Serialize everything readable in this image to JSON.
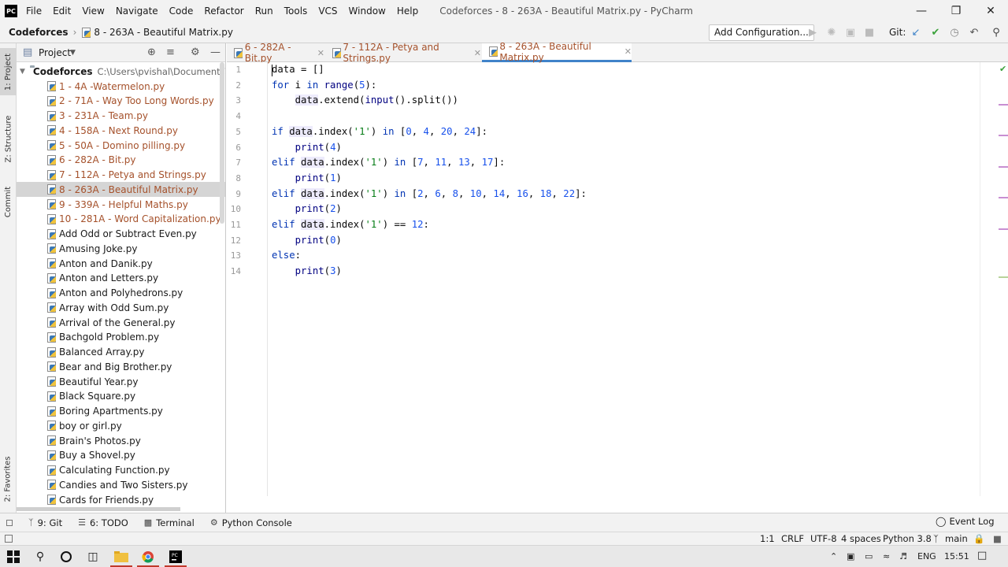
{
  "app": {
    "logo": "PC",
    "window_title": "Codeforces - 8 - 263A - Beautiful Matrix.py - PyCharm",
    "menu": [
      "File",
      "Edit",
      "View",
      "Navigate",
      "Code",
      "Refactor",
      "Run",
      "Tools",
      "VCS",
      "Window",
      "Help"
    ]
  },
  "navbar": {
    "project": "Codeforces",
    "file": "8 - 263A - Beautiful Matrix.py",
    "add_configuration": "Add Configuration...",
    "git_label": "Git:"
  },
  "left_strip": {
    "project_tab": "1: Project",
    "structure_tab": "Z: Structure",
    "commit_tab": "Commit",
    "favorites_tab": "2: Favorites"
  },
  "project_panel": {
    "title": "Project",
    "root_name": "Codeforces",
    "root_path": "C:\\Users\\pvishal\\Documents\\Cod",
    "files": [
      {
        "name": "1 - 4A -Watermelon.py",
        "modified": true,
        "selected": false
      },
      {
        "name": "2 - 71A - Way Too Long Words.py",
        "modified": true,
        "selected": false
      },
      {
        "name": "3 - 231A - Team.py",
        "modified": true,
        "selected": false
      },
      {
        "name": "4 - 158A - Next Round.py",
        "modified": true,
        "selected": false
      },
      {
        "name": "5 - 50A - Domino pilling.py",
        "modified": true,
        "selected": false
      },
      {
        "name": "6 - 282A - Bit.py",
        "modified": true,
        "selected": false
      },
      {
        "name": "7 - 112A - Petya and Strings.py",
        "modified": true,
        "selected": false
      },
      {
        "name": "8 - 263A - Beautiful Matrix.py",
        "modified": true,
        "selected": true
      },
      {
        "name": "9 - 339A - Helpful Maths.py",
        "modified": true,
        "selected": false
      },
      {
        "name": "10 - 281A - Word Capitalization.py",
        "modified": true,
        "selected": false
      },
      {
        "name": "Add Odd or Subtract Even.py",
        "modified": false,
        "selected": false
      },
      {
        "name": "Amusing Joke.py",
        "modified": false,
        "selected": false
      },
      {
        "name": "Anton and Danik.py",
        "modified": false,
        "selected": false
      },
      {
        "name": "Anton and Letters.py",
        "modified": false,
        "selected": false
      },
      {
        "name": "Anton and Polyhedrons.py",
        "modified": false,
        "selected": false
      },
      {
        "name": "Array with Odd Sum.py",
        "modified": false,
        "selected": false
      },
      {
        "name": "Arrival of the General.py",
        "modified": false,
        "selected": false
      },
      {
        "name": "Bachgold Problem.py",
        "modified": false,
        "selected": false
      },
      {
        "name": "Balanced Array.py",
        "modified": false,
        "selected": false
      },
      {
        "name": "Bear and Big Brother.py",
        "modified": false,
        "selected": false
      },
      {
        "name": "Beautiful Year.py",
        "modified": false,
        "selected": false
      },
      {
        "name": "Black Square.py",
        "modified": false,
        "selected": false
      },
      {
        "name": "Boring Apartments.py",
        "modified": false,
        "selected": false
      },
      {
        "name": "boy or girl.py",
        "modified": false,
        "selected": false
      },
      {
        "name": "Brain's Photos.py",
        "modified": false,
        "selected": false
      },
      {
        "name": "Buy a Shovel.py",
        "modified": false,
        "selected": false
      },
      {
        "name": "Calculating Function.py",
        "modified": false,
        "selected": false
      },
      {
        "name": "Candies and Two Sisters.py",
        "modified": false,
        "selected": false
      },
      {
        "name": "Cards for Friends.py",
        "modified": false,
        "selected": false
      }
    ]
  },
  "editor_tabs": [
    {
      "label": "6 - 282A - Bit.py",
      "active": false
    },
    {
      "label": "7 - 112A - Petya and Strings.py",
      "active": false
    },
    {
      "label": "8 - 263A - Beautiful Matrix.py",
      "active": true
    }
  ],
  "code_lines": [
    [
      [
        "v",
        "data"
      ],
      [
        "p",
        " = []"
      ]
    ],
    [
      [
        "k",
        "for"
      ],
      [
        "p",
        " i "
      ],
      [
        "k",
        "in"
      ],
      [
        "p",
        " "
      ],
      [
        "b",
        "range"
      ],
      [
        "p",
        "("
      ],
      [
        "n",
        "5"
      ],
      [
        "p",
        "):"
      ]
    ],
    [
      [
        "p",
        "    "
      ],
      [
        "v",
        "data"
      ],
      [
        "p",
        ".extend("
      ],
      [
        "b",
        "input"
      ],
      [
        "p",
        "().split())"
      ]
    ],
    [],
    [
      [
        "k",
        "if"
      ],
      [
        "p",
        " "
      ],
      [
        "v",
        "data"
      ],
      [
        "p",
        ".index("
      ],
      [
        "s",
        "'1'"
      ],
      [
        "p",
        ") "
      ],
      [
        "k",
        "in"
      ],
      [
        "p",
        " ["
      ],
      [
        "n",
        "0"
      ],
      [
        "p",
        ", "
      ],
      [
        "n",
        "4"
      ],
      [
        "p",
        ", "
      ],
      [
        "n",
        "20"
      ],
      [
        "p",
        ", "
      ],
      [
        "n",
        "24"
      ],
      [
        "p",
        "]:"
      ]
    ],
    [
      [
        "p",
        "    "
      ],
      [
        "b",
        "print"
      ],
      [
        "p",
        "("
      ],
      [
        "n",
        "4"
      ],
      [
        "p",
        ")"
      ]
    ],
    [
      [
        "k",
        "elif"
      ],
      [
        "p",
        " "
      ],
      [
        "v",
        "data"
      ],
      [
        "p",
        ".index("
      ],
      [
        "s",
        "'1'"
      ],
      [
        "p",
        ") "
      ],
      [
        "k",
        "in"
      ],
      [
        "p",
        " ["
      ],
      [
        "n",
        "7"
      ],
      [
        "p",
        ", "
      ],
      [
        "n",
        "11"
      ],
      [
        "p",
        ", "
      ],
      [
        "n",
        "13"
      ],
      [
        "p",
        ", "
      ],
      [
        "n",
        "17"
      ],
      [
        "p",
        "]:"
      ]
    ],
    [
      [
        "p",
        "    "
      ],
      [
        "b",
        "print"
      ],
      [
        "p",
        "("
      ],
      [
        "n",
        "1"
      ],
      [
        "p",
        ")"
      ]
    ],
    [
      [
        "k",
        "elif"
      ],
      [
        "p",
        " "
      ],
      [
        "v",
        "data"
      ],
      [
        "p",
        ".index("
      ],
      [
        "s",
        "'1'"
      ],
      [
        "p",
        ") "
      ],
      [
        "k",
        "in"
      ],
      [
        "p",
        " ["
      ],
      [
        "n",
        "2"
      ],
      [
        "p",
        ", "
      ],
      [
        "n",
        "6"
      ],
      [
        "p",
        ", "
      ],
      [
        "n",
        "8"
      ],
      [
        "p",
        ", "
      ],
      [
        "n",
        "10"
      ],
      [
        "p",
        ", "
      ],
      [
        "n",
        "14"
      ],
      [
        "p",
        ", "
      ],
      [
        "n",
        "16"
      ],
      [
        "p",
        ", "
      ],
      [
        "n",
        "18"
      ],
      [
        "p",
        ", "
      ],
      [
        "n",
        "22"
      ],
      [
        "p",
        "]:"
      ]
    ],
    [
      [
        "p",
        "    "
      ],
      [
        "b",
        "print"
      ],
      [
        "p",
        "("
      ],
      [
        "n",
        "2"
      ],
      [
        "p",
        ")"
      ]
    ],
    [
      [
        "k",
        "elif"
      ],
      [
        "p",
        " "
      ],
      [
        "v",
        "data"
      ],
      [
        "p",
        ".index("
      ],
      [
        "s",
        "'1'"
      ],
      [
        "p",
        ") == "
      ],
      [
        "n",
        "12"
      ],
      [
        "p",
        ":"
      ]
    ],
    [
      [
        "p",
        "    "
      ],
      [
        "b",
        "print"
      ],
      [
        "p",
        "("
      ],
      [
        "n",
        "0"
      ],
      [
        "p",
        ")"
      ]
    ],
    [
      [
        "k",
        "else"
      ],
      [
        "p",
        ":"
      ]
    ],
    [
      [
        "p",
        "    "
      ],
      [
        "b",
        "print"
      ],
      [
        "p",
        "("
      ],
      [
        "n",
        "3"
      ],
      [
        "p",
        ")"
      ]
    ]
  ],
  "bottom_tools": [
    {
      "icon": "git-branch-icon",
      "label": "9: Git"
    },
    {
      "icon": "todo-list-icon",
      "label": "6: TODO"
    },
    {
      "icon": "terminal-icon",
      "label": "Terminal"
    },
    {
      "icon": "python-console-icon",
      "label": "Python Console"
    }
  ],
  "event_log": "Event Log",
  "status": {
    "position": "1:1",
    "line_separator": "CRLF",
    "encoding": "UTF-8",
    "indent": "4 spaces",
    "interpreter": "Python 3.8",
    "branch": "main"
  },
  "taskbar": {
    "language": "ENG",
    "time": "15:51"
  },
  "colors": {
    "keyword": "#0033b3",
    "number": "#1750eb",
    "string": "#067d17",
    "modified_file": "#a5512b",
    "active_tab_underline": "#4083c9"
  }
}
